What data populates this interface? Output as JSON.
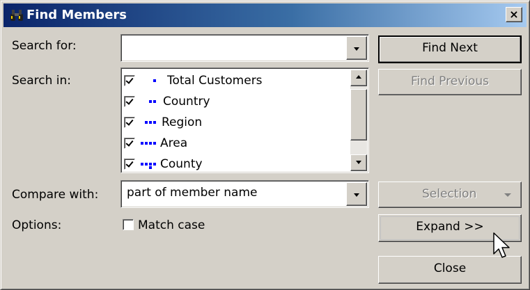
{
  "window": {
    "title": "Find Members",
    "close_label": "×"
  },
  "search_for": {
    "label": "Search for:",
    "value": ""
  },
  "search_in": {
    "label": "Search in:",
    "items": [
      {
        "label": "Total Customers",
        "checked": true,
        "level": 1
      },
      {
        "label": "Country",
        "checked": true,
        "level": 2
      },
      {
        "label": "Region",
        "checked": true,
        "level": 3
      },
      {
        "label": "Area",
        "checked": true,
        "level": 4
      },
      {
        "label": "County",
        "checked": true,
        "level": 5
      }
    ]
  },
  "compare_with": {
    "label": "Compare with:",
    "value": "part of member name"
  },
  "options": {
    "label": "Options:",
    "match_case_label": "Match case",
    "match_case_checked": false
  },
  "buttons": {
    "find_next": "Find Next",
    "find_previous": "Find Previous",
    "selection": "Selection",
    "expand": "Expand >>",
    "close": "Close"
  },
  "colors": {
    "title_start": "#0a246a",
    "title_end": "#a6caf0",
    "level_marker": "#0000ff",
    "dialog_bg": "#d4d0c8"
  },
  "icons": {
    "title": "binoculars-icon",
    "cursor": "mouse-pointer-icon"
  }
}
